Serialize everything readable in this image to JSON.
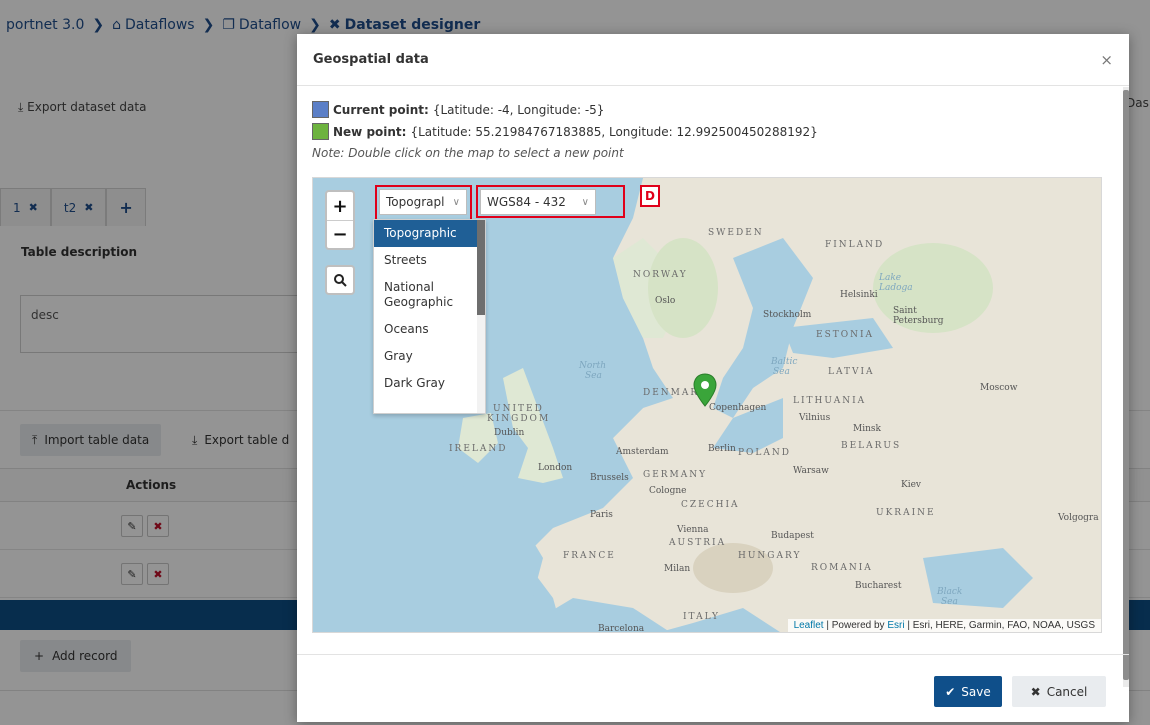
{
  "breadcrumb": {
    "items": [
      "portnet 3.0",
      "Dataflows",
      "Dataflow",
      "Dataset designer"
    ],
    "icons": [
      "chevron-right",
      "home-icon",
      "copy-icon",
      "tools-icon"
    ]
  },
  "background": {
    "export_dataset_label": "Export dataset data",
    "right_cut_text": "Das",
    "tabs": [
      {
        "label": "1"
      },
      {
        "label": "t2"
      }
    ],
    "table_description_label": "Table description",
    "description_value": "desc",
    "import_table_label": "Import table data",
    "export_table_label": "Export table d",
    "actions_header": "Actions",
    "add_record_label": "Add record"
  },
  "modal": {
    "title": "Geospatial data",
    "close_glyph": "×",
    "current_point": {
      "label": "Current point:",
      "value": "{Latitude: -4, Longitude: -5}",
      "color": "#5b7fc7"
    },
    "new_point": {
      "label": "New point:",
      "value": "{Latitude: 55.21984767183885, Longitude: 12.992500450288192}",
      "color": "#6db33f"
    },
    "note": "Note: Double click on the map to select a new point",
    "save_label": "Save",
    "cancel_label": "Cancel"
  },
  "map": {
    "basemap_selected": "Topograpl",
    "crs_selected": "WGS84 - 432",
    "annotation_badge": "D",
    "basemap_options": [
      "Topographic",
      "Streets",
      "National Geographic",
      "Oceans",
      "Gray",
      "Dark Gray"
    ],
    "zoom_in": "+",
    "zoom_out": "−",
    "attribution": {
      "leaflet": "Leaflet",
      "powered": " | Powered by ",
      "esri": "Esri",
      "rest": " | Esri, HERE, Garmin, FAO, NOAA, USGS"
    },
    "labels": {
      "sweden": "SWEDEN",
      "finland": "FINLAND",
      "norway": "NORWAY",
      "estonia": "ESTONIA",
      "latvia": "LATVIA",
      "lithuania": "LITHUANIA",
      "belarus": "BELARUS",
      "denmark": "DENMAR",
      "uk": "UNITED",
      "uk2": "KINGDOM",
      "ireland": "IRELAND",
      "germany": "GERMANY",
      "poland": "POLAND",
      "czechia": "CZECHIA",
      "austria": "AUSTRIA",
      "hungary": "HUNGARY",
      "romania": "ROMANIA",
      "ukraine": "UKRAINE",
      "france": "FRANCE",
      "italy": "ITALY",
      "north_sea": "North",
      "north_sea2": "Sea",
      "baltic": "Baltic",
      "baltic2": "Sea",
      "black": "Black",
      "black2": "Sea",
      "oslo": "Oslo",
      "stockholm": "Stockholm",
      "helsinki": "Helsinki",
      "saint": "Saint",
      "petersburg": "Petersburg",
      "copenhagen": "Copenhagen",
      "vilnius": "Vilnius",
      "minsk": "Minsk",
      "moscow": "Moscow",
      "dublin": "Dublin",
      "london": "London",
      "amsterdam": "Amsterdam",
      "berlin": "Berlin",
      "warsaw": "Warsaw",
      "brussels": "Brussels",
      "cologne": "Cologne",
      "kiev": "Kiev",
      "paris": "Paris",
      "vienna": "Vienna",
      "budapest": "Budapest",
      "milan": "Milan",
      "bucharest": "Bucharest",
      "volgograd": "Volgogra",
      "barcelona": "Barcelona",
      "lake": "Lake",
      "ladoga": "Ladoga"
    }
  }
}
